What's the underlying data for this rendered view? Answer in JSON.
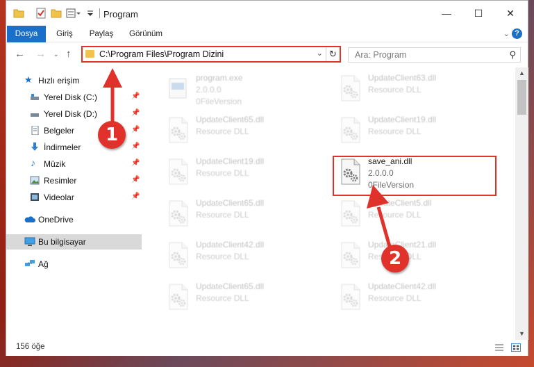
{
  "window": {
    "title": "Program"
  },
  "ribbon": {
    "tabs": [
      "Dosya",
      "Giriş",
      "Paylaş",
      "Görünüm"
    ],
    "active_index": 0
  },
  "address": {
    "path": "C:\\Program Files\\Program Dizini"
  },
  "search": {
    "placeholder": "Ara: Program"
  },
  "sidebar": {
    "quick_access": "Hızlı erişim",
    "items": [
      {
        "label": "Yerel Disk (C:)",
        "icon": "drive-icon",
        "pinned": true
      },
      {
        "label": "Yerel Disk (D:)",
        "icon": "drive-icon",
        "pinned": true
      },
      {
        "label": "Belgeler",
        "icon": "documents-icon",
        "pinned": true
      },
      {
        "label": "İndirmeler",
        "icon": "download-icon",
        "pinned": true
      },
      {
        "label": "Müzik",
        "icon": "music-icon",
        "pinned": true
      },
      {
        "label": "Resimler",
        "icon": "pictures-icon",
        "pinned": true
      },
      {
        "label": "Videolar",
        "icon": "videos-icon",
        "pinned": true
      }
    ],
    "onedrive": "OneDrive",
    "this_pc": "Bu bilgisayar",
    "network": "Ağ"
  },
  "files": [
    {
      "name": "program.exe",
      "type": "2.0.0.0",
      "version": "0FileVersion",
      "faded": true,
      "kind": "exe"
    },
    {
      "name": "UpdateClient63.dll",
      "type": "Resource DLL",
      "version": "",
      "faded": true,
      "kind": "dll"
    },
    {
      "name": "UpdateClient65.dll",
      "type": "Resource DLL",
      "version": "",
      "faded": true,
      "kind": "dll"
    },
    {
      "name": "UpdateClient19.dll",
      "type": "Resource DLL",
      "version": "",
      "faded": true,
      "kind": "dll"
    },
    {
      "name": "UpdateClient19.dll",
      "type": "Resource DLL",
      "version": "",
      "faded": true,
      "kind": "dll"
    },
    {
      "name": "save_ani.dll",
      "type": "2.0.0.0",
      "version": "0FileVersion",
      "faded": false,
      "kind": "dll"
    },
    {
      "name": "UpdateClient65.dll",
      "type": "Resource DLL",
      "version": "",
      "faded": true,
      "kind": "dll"
    },
    {
      "name": "UpdateClient5.dll",
      "type": "Resource DLL",
      "version": "",
      "faded": true,
      "kind": "dll"
    },
    {
      "name": "UpdateClient42.dll",
      "type": "Resource DLL",
      "version": "",
      "faded": true,
      "kind": "dll"
    },
    {
      "name": "UpdateClient21.dll",
      "type": "Resource DLL",
      "version": "",
      "faded": true,
      "kind": "dll"
    },
    {
      "name": "UpdateClient65.dll",
      "type": "Resource DLL",
      "version": "",
      "faded": true,
      "kind": "dll"
    },
    {
      "name": "UpdateClient42.dll",
      "type": "Resource DLL",
      "version": "",
      "faded": true,
      "kind": "dll"
    }
  ],
  "status": {
    "count": "156 öğe"
  },
  "callouts": [
    "1",
    "2"
  ],
  "colors": {
    "accent": "#1a6fc9",
    "highlight": "#e0312b",
    "folder": "#f2c34b"
  }
}
